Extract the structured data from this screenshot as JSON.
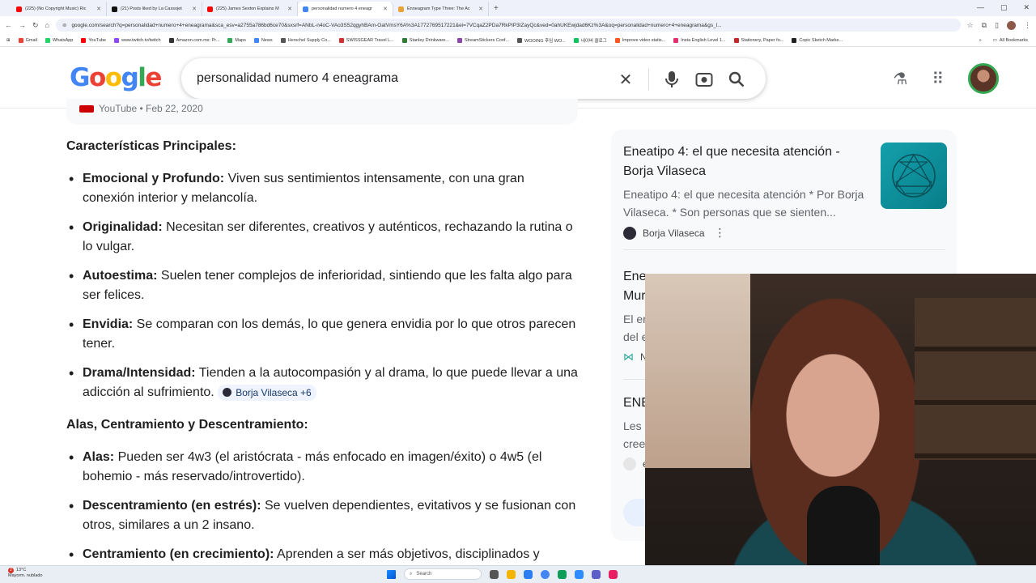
{
  "browser": {
    "tabs": [
      {
        "label": "(225) (No Copyright Music) Ric",
        "color": "#ff0000",
        "active": false
      },
      {
        "label": "(21) Posts liked by La Cassojet",
        "color": "#111111",
        "active": false
      },
      {
        "label": "(225) James Sexton Explains M",
        "color": "#ff0000",
        "active": false
      },
      {
        "label": "personalidad numero 4 eneagr",
        "color": "#4285f4",
        "active": true
      },
      {
        "label": "Enneagram Type Three: The Ac",
        "color": "#e8a23a",
        "active": false
      }
    ],
    "new_tab": "+",
    "url": "google.com/search?q=personalidad+numero+4+eneagrama&sca_esv=a2755a786bd6ce70&sxsrf=ANbL-n4oC-VAo3S52qgyhBAm-OatVmsY6A%3A1772769517221&ei=7VCqaZ2PDa7RkPIP3IZayQc&ved=0ahUKEwjdad6Kz%3A&oq=personalidad+numero+4+eneagrama&gs_l...",
    "bookmarks": [
      {
        "label": "Gmail",
        "color": "#ea4335"
      },
      {
        "label": "WhatsApp",
        "color": "#25d366"
      },
      {
        "label": "YouTube",
        "color": "#ff0000"
      },
      {
        "label": "www.twitch.tv/twitch",
        "color": "#9146ff"
      },
      {
        "label": "Amazon.com.mx: Pr...",
        "color": "#333333"
      },
      {
        "label": "Maps",
        "color": "#34a853"
      },
      {
        "label": "News",
        "color": "#4285f4"
      },
      {
        "label": "Herschel Supply Co...",
        "color": "#555555"
      },
      {
        "label": "SWISSGEAR Travel L...",
        "color": "#d32f2f"
      },
      {
        "label": "Stanley Drinkware...",
        "color": "#2e7d32"
      },
      {
        "label": "StreamStickers Conf...",
        "color": "#8e44ad"
      },
      {
        "label": "WOOING 후임 WO...",
        "color": "#555555"
      },
      {
        "label": "네이버 클로그",
        "color": "#03c75a"
      },
      {
        "label": "Improve video statis...",
        "color": "#ff5722"
      },
      {
        "label": "Insta English Level 1...",
        "color": "#e1306c"
      },
      {
        "label": "Stationery, Paper fo...",
        "color": "#c62828"
      },
      {
        "label": "Copic Sketch Marke...",
        "color": "#212121"
      }
    ],
    "all_bookmarks": "All Bookmarks"
  },
  "google": {
    "logo": "Google",
    "logo_colors": [
      "#4285f4",
      "#ea4335",
      "#fbbc05",
      "#4285f4",
      "#34a853",
      "#ea4335"
    ],
    "query": "personalidad numero 4 eneagrama"
  },
  "main": {
    "prev_source": "YouTube • Feb 22, 2020",
    "section1": "Características Principales:",
    "items1": [
      {
        "term": "Emocional y Profundo:",
        "text": " Viven sus sentimientos intensamente, con una gran conexión interior y melancolía."
      },
      {
        "term": "Originalidad:",
        "text": " Necesitan ser diferentes, creativos y auténticos, rechazando la rutina o lo vulgar."
      },
      {
        "term": "Autoestima:",
        "text": " Suelen tener complejos de inferioridad, sintiendo que les falta algo para ser felices."
      },
      {
        "term": "Envidia:",
        "text": " Se comparan con los demás, lo que genera envidia por lo que otros parecen tener."
      },
      {
        "term": "Drama/Intensidad:",
        "text": " Tienden a la autocompasión y al drama, lo que puede llevar a una adicción al sufrimiento. "
      }
    ],
    "citation_chip": "Borja Vilaseca +6",
    "section2": "Alas, Centramiento y Descentramiento:",
    "items2": [
      {
        "term": "Alas:",
        "text": " Pueden ser 4w3 (el aristócrata - más enfocado en imagen/éxito) o 4w5 (el bohemio - más reservado/introvertido)."
      },
      {
        "term": "Descentramiento (en estrés):",
        "text": " Se vuelven dependientes, evitativos y se fusionan con otros, similares a un 2 insano."
      },
      {
        "term": "Centramiento (en crecimiento):",
        "text": " Aprenden a ser más objetivos, disciplinados y"
      }
    ]
  },
  "panel": {
    "card1": {
      "title": "Eneatipo 4: el que necesita atención - Borja Vilaseca",
      "desc": "Eneatipo 4: el que necesita atención * Por Borja Vilaseca. * Son personas que se sienten...",
      "source": "Borja Vilaseca"
    },
    "card2": {
      "title": "Ene",
      "title2": "Mur",
      "desc": "El er",
      "desc2": "del e",
      "source": "N"
    },
    "card3": {
      "title": "ENE",
      "desc": "Les",
      "desc2": "cree",
      "source": "e"
    }
  },
  "taskbar": {
    "weather_temp": "13°C",
    "weather_desc": "Mayorm. nublado",
    "search": "Search",
    "notification_count": "2"
  }
}
